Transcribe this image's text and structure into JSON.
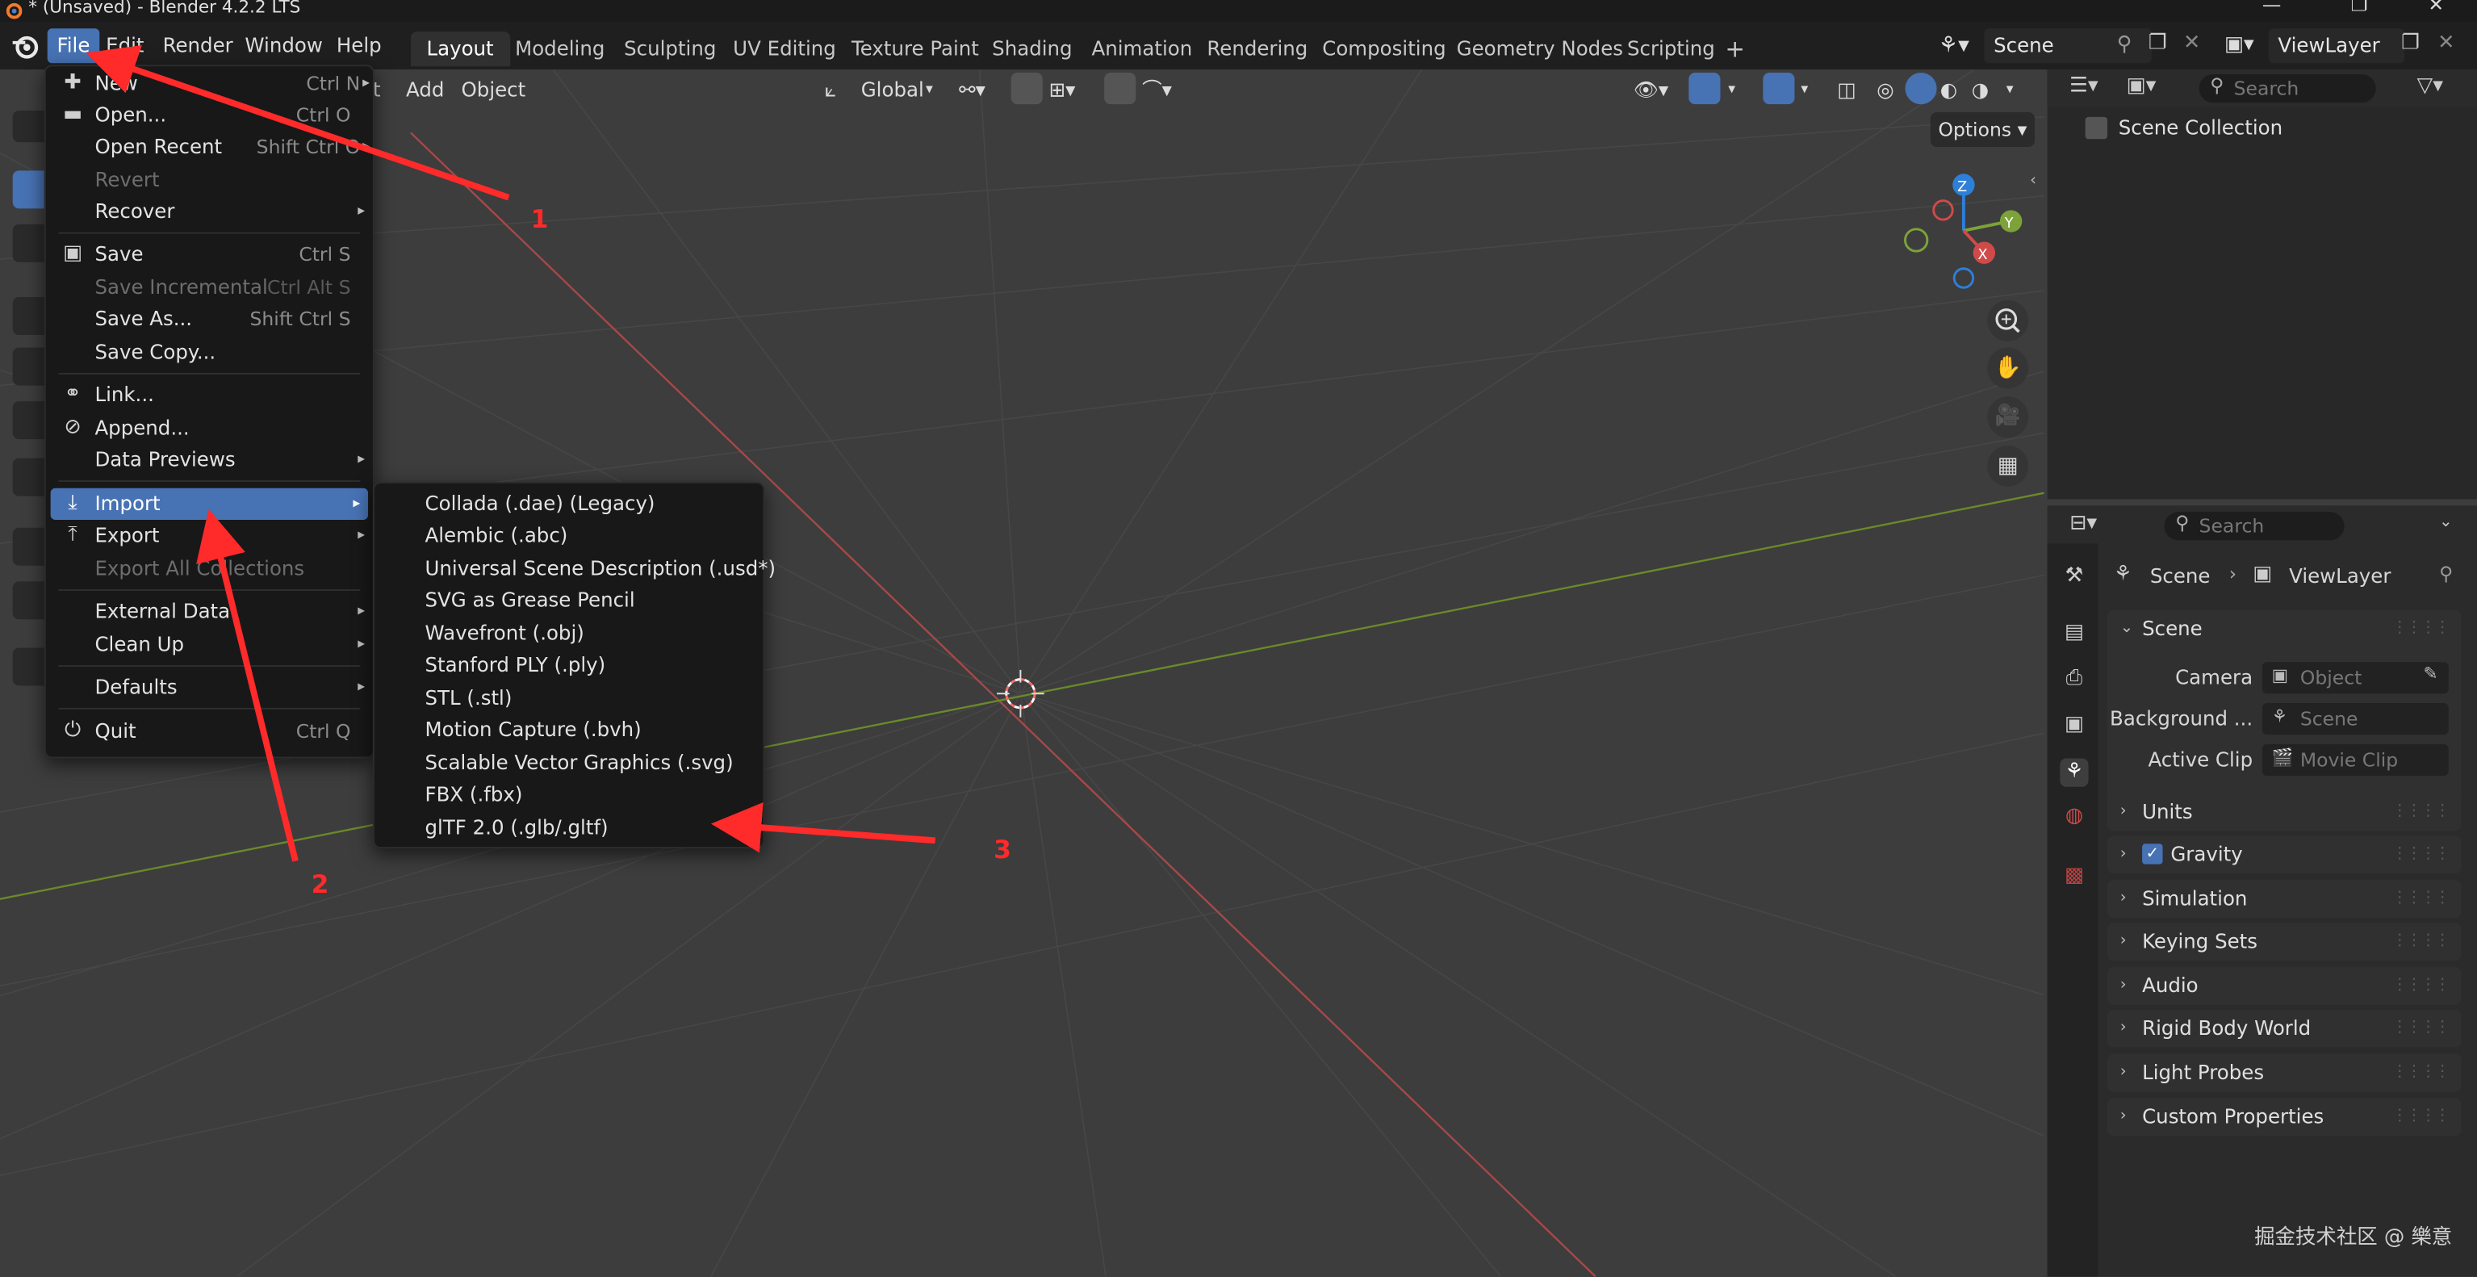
{
  "window": {
    "title": "* (Unsaved) - Blender 4.2.2 LTS",
    "controls": [
      "—",
      "❐",
      "✕"
    ]
  },
  "menubar": {
    "items": [
      "File",
      "Edit",
      "Render",
      "Window",
      "Help"
    ],
    "active": "File"
  },
  "workspaces": {
    "tabs": [
      "Layout",
      "Modeling",
      "Sculpting",
      "UV Editing",
      "Texture Paint",
      "Shading",
      "Animation",
      "Rendering",
      "Compositing",
      "Geometry Nodes",
      "Scripting"
    ],
    "active": "Layout",
    "add_label": "+"
  },
  "scene_selector": {
    "value": "Scene"
  },
  "viewlayer_selector": {
    "value": "ViewLayer"
  },
  "viewport_header": {
    "partial_menu": "t",
    "add": "Add",
    "object": "Object",
    "orientation": "Global"
  },
  "viewport": {
    "options_label": "Options"
  },
  "gizmo": {
    "z": "Z",
    "y": "Y",
    "x": "X"
  },
  "file_menu": {
    "items": [
      {
        "label": "New",
        "shortcut": "Ctrl N",
        "arrow": "▸",
        "icon": "new-file-icon"
      },
      {
        "label": "Open...",
        "shortcut": "Ctrl O",
        "icon": "folder-icon"
      },
      {
        "label": "Open Recent",
        "shortcut": "Shift Ctrl O",
        "arrow": "▸"
      },
      {
        "label": "Revert",
        "disabled": true
      },
      {
        "label": "Recover",
        "arrow": "▸"
      },
      {
        "label": "Save",
        "shortcut": "Ctrl S",
        "icon": "save-icon"
      },
      {
        "label": "Save Incremental",
        "shortcut": "Ctrl Alt S",
        "disabled": true
      },
      {
        "label": "Save As...",
        "shortcut": "Shift Ctrl S"
      },
      {
        "label": "Save Copy..."
      },
      {
        "label": "Link...",
        "icon": "link-icon"
      },
      {
        "label": "Append...",
        "icon": "append-icon"
      },
      {
        "label": "Data Previews",
        "arrow": "▸"
      },
      {
        "label": "Import",
        "arrow": "▸",
        "icon": "import-icon",
        "highlighted": true
      },
      {
        "label": "Export",
        "arrow": "▸",
        "icon": "export-icon"
      },
      {
        "label": "Export All Collections",
        "disabled": true
      },
      {
        "label": "External Data",
        "arrow": "▸"
      },
      {
        "label": "Clean Up",
        "arrow": "▸"
      },
      {
        "label": "Defaults",
        "arrow": "▸"
      },
      {
        "label": "Quit",
        "shortcut": "Ctrl Q",
        "icon": "quit-icon"
      }
    ]
  },
  "import_menu": {
    "items": [
      "Collada (.dae) (Legacy)",
      "Alembic (.abc)",
      "Universal Scene Description (.usd*)",
      "SVG as Grease Pencil",
      "Wavefront (.obj)",
      "Stanford PLY (.ply)",
      "STL (.stl)",
      "Motion Capture (.bvh)",
      "Scalable Vector Graphics (.svg)",
      "FBX (.fbx)",
      "glTF 2.0 (.glb/.gltf)"
    ]
  },
  "outliner": {
    "search_placeholder": "Search",
    "root": "Scene Collection"
  },
  "properties": {
    "search_placeholder": "Search",
    "breadcrumb": [
      "Scene",
      "ViewLayer"
    ],
    "scene_panel": {
      "title": "Scene",
      "fields": [
        {
          "label": "Camera",
          "value": "Object"
        },
        {
          "label": "Background ...",
          "value": "Scene"
        },
        {
          "label": "Active Clip",
          "value": "Movie Clip"
        }
      ]
    },
    "panels": [
      "Units",
      "Gravity",
      "Simulation",
      "Keying Sets",
      "Audio",
      "Rigid Body World",
      "Light Probes",
      "Custom Properties"
    ],
    "gravity_checked": true
  },
  "annotations": {
    "labels": [
      "1",
      "2",
      "3"
    ],
    "color": "#ff2a2a"
  },
  "watermark": "掘金技术社区 @ 樂意",
  "colors": {
    "accent": "#4772b3",
    "x_axis": "#d04a4a",
    "y_axis": "#7ea23a",
    "z_axis": "#2e7fd8"
  }
}
